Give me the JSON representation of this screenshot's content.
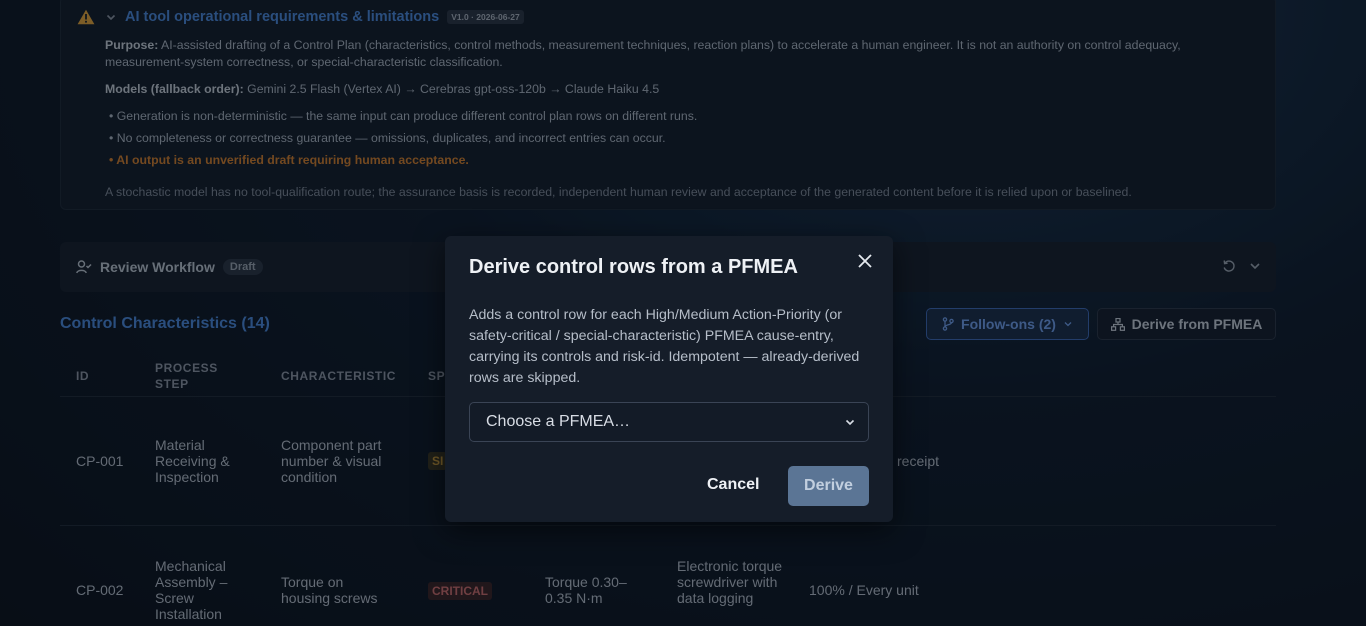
{
  "ai_panel": {
    "title": "AI tool operational requirements & limitations",
    "version_badge": "V1.0 · 2026-06-27",
    "purpose_label": "Purpose:",
    "purpose_text": " AI-assisted drafting of a Control Plan (characteristics, control methods, measurement techniques, reaction plans) to accelerate a human engineer. It is not an authority on control adequacy, measurement-system correctness, or special-characteristic classification.",
    "models_label": "Models (fallback order):",
    "models_text": " Gemini 2.5 Flash (Vertex AI) → Cerebras gpt-oss-120b → Claude Haiku 4.5",
    "bullets": [
      "• Generation is non-deterministic — the same input can produce different control plan rows on different runs.",
      "• No completeness or correctness guarantee — omissions, duplicates, and incorrect entries can occur.",
      "• AI output is an unverified draft requiring human acceptance."
    ],
    "note": "A stochastic model has no tool-qualification route; the assurance basis is recorded, independent human review and acceptance of the generated content before it is relied upon or baselined."
  },
  "review": {
    "title": "Review Workflow",
    "badge": "Draft"
  },
  "characteristics": {
    "title": "Control Characteristics (14)",
    "follow_ons": "Follow-ons (2)",
    "derive_button": "Derive from PFMEA",
    "headers": [
      "ID",
      "PROCESS STEP",
      "CHARACTERISTIC",
      "SP"
    ],
    "rows": [
      {
        "id": "CP-001",
        "process_step": "Material Receiving & Inspection",
        "characteristic": "Component part number & visual condition",
        "special": "SI",
        "frequency": "receipt"
      },
      {
        "id": "CP-002",
        "process_step": "Mechanical Assembly – Screw Installation",
        "characteristic": "Torque on housing screws",
        "special": "CRITICAL",
        "spec": "Torque 0.30–0.35 N·m",
        "method": "Electronic torque screwdriver with data logging",
        "frequency": "100% / Every unit"
      }
    ]
  },
  "modal": {
    "title": "Derive control rows from a PFMEA",
    "description": "Adds a control row for each High/Medium Action-Priority (or safety-critical / special-characteristic) PFMEA cause-entry, carrying its controls and risk-id. Idempotent — already-derived rows are skipped.",
    "select_placeholder": "Choose a PFMEA…",
    "cancel": "Cancel",
    "derive": "Derive"
  },
  "colors": {
    "accent": "#4a86d8",
    "warning": "#d07d2c",
    "critical": "#c96a6a"
  }
}
